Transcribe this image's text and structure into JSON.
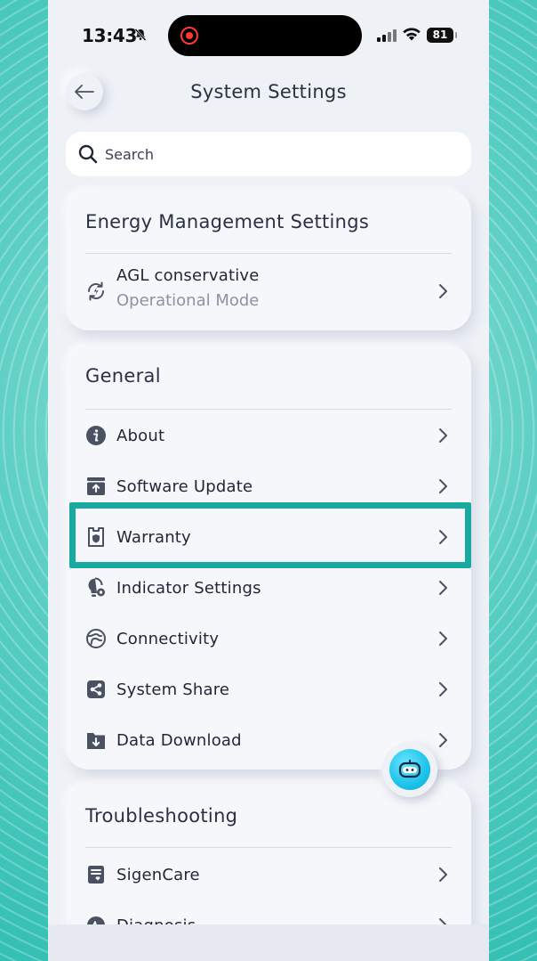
{
  "status_bar": {
    "time": "13:43",
    "battery": "81",
    "icons": [
      "bell-slash-icon",
      "screen-record-icon",
      "signal-icon",
      "wifi-icon",
      "battery-icon"
    ]
  },
  "header": {
    "title": "System Settings",
    "back_icon": "arrow-left-icon"
  },
  "search": {
    "placeholder": "Search",
    "icon": "search-icon"
  },
  "energy_card": {
    "title": "Energy Management Settings",
    "item": {
      "label": "AGL conservative",
      "sublabel": "Operational Mode",
      "icon": "refresh-lightning-icon"
    }
  },
  "general_card": {
    "title": "General",
    "items": [
      {
        "label": "About",
        "icon": "info-icon"
      },
      {
        "label": "Software Update",
        "icon": "upload-box-icon"
      },
      {
        "label": "Warranty",
        "icon": "shield-doc-icon"
      },
      {
        "label": "Indicator Settings",
        "icon": "bulb-gear-icon"
      },
      {
        "label": "Connectivity",
        "icon": "globe-icon"
      },
      {
        "label": "System Share",
        "icon": "share-icon"
      },
      {
        "label": "Data Download",
        "icon": "download-folder-icon"
      }
    ]
  },
  "troubleshooting_card": {
    "title": "Troubleshooting",
    "items": [
      {
        "label": "SigenCare",
        "icon": "care-doc-icon"
      },
      {
        "label": "Diagnosis",
        "icon": "diagnosis-icon"
      }
    ]
  },
  "colors": {
    "accent_highlight": "#18aaa0",
    "text_primary": "#1f2636",
    "text_secondary": "#8b93a1",
    "icon": "#4a5262",
    "assistant": "#1cc3ea"
  }
}
